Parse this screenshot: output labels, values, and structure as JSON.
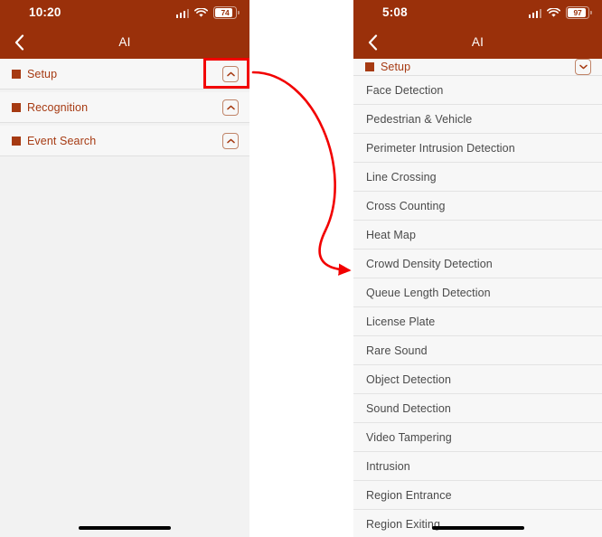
{
  "left_phone": {
    "status": {
      "time": "10:20",
      "battery": "74",
      "wifi_icon": "wifi-icon",
      "cellular_icon": "cellular-signal-icon",
      "battery_icon": "battery-icon"
    },
    "nav": {
      "back_icon": "chevron-left-icon",
      "title": "AI"
    },
    "sections": [
      {
        "label": "Setup",
        "toggle_icon": "chevron-up-icon",
        "bullet_icon": "square-bullet-icon"
      },
      {
        "label": "Recognition",
        "toggle_icon": "chevron-up-icon",
        "bullet_icon": "square-bullet-icon"
      },
      {
        "label": "Event Search",
        "toggle_icon": "chevron-up-icon",
        "bullet_icon": "square-bullet-icon"
      }
    ],
    "home_indicator": "home-indicator"
  },
  "right_phone": {
    "status": {
      "time": "5:08",
      "battery": "97",
      "wifi_icon": "wifi-icon",
      "cellular_icon": "cellular-signal-icon",
      "battery_icon": "battery-icon"
    },
    "nav": {
      "back_icon": "chevron-left-icon",
      "title": "AI"
    },
    "sections": [
      {
        "label": "Setup",
        "toggle_icon": "chevron-down-icon",
        "bullet_icon": "square-bullet-icon"
      }
    ],
    "items": [
      "Face Detection",
      "Pedestrian & Vehicle",
      "Perimeter Intrusion Detection",
      "Line Crossing",
      "Cross Counting",
      "Heat Map",
      "Crowd Density Detection",
      "Queue Length Detection",
      "License Plate",
      "Rare Sound",
      "Object Detection",
      "Sound Detection",
      "Video Tampering",
      "Intrusion",
      "Region Entrance",
      "Region Exiting"
    ],
    "home_indicator": "home-indicator"
  },
  "annotations": {
    "highlight_box": "setup-toggle-highlight",
    "arrow": "curved-red-arrow",
    "accent_color": "#f20000"
  },
  "colors": {
    "header": "#9a300a",
    "accent_text": "#a63a12",
    "row_bg": "#f7f7f7",
    "page_bg": "#f2f2f2",
    "item_text": "#4a4a4a"
  }
}
